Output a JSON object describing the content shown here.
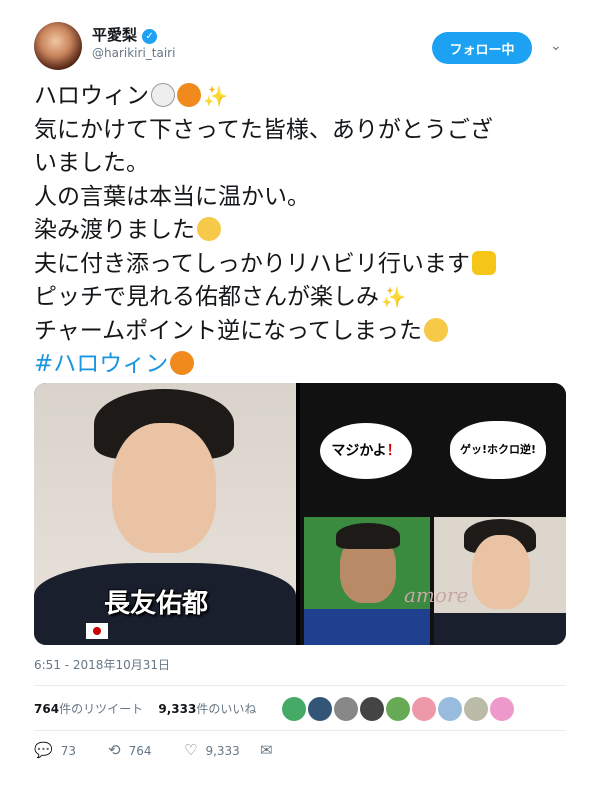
{
  "profile": {
    "name": "平愛梨",
    "handle": "@harikiri_tairi",
    "follow_label": "フォロー中"
  },
  "tweet": {
    "lines": [
      "ハロウィン",
      "気にかけて下さってた皆様、ありがとうござ",
      "いました。",
      "人の言葉は本当に温かい。",
      "染み渡りました",
      "夫に付き添ってしっかりリハビリ行います",
      "ピッチで見れる佑都さんが楽しみ",
      "チャームポイント逆になってしまった"
    ],
    "hashtag": "#ハロウィン",
    "sparkle": "✨"
  },
  "media": {
    "left_caption": "長友佑都",
    "bubble1": "マジかよ",
    "bubble1_mark": "！",
    "bubble2": "ゲッ!ホクロ逆!",
    "amore": "amore"
  },
  "timestamp": "6:51 - 2018年10月31日",
  "stats": {
    "retweets_count": "764",
    "retweets_label": "件のリツイート",
    "likes_count": "9,333",
    "likes_label": "件のいいね"
  },
  "actions": {
    "reply_count": "73",
    "retweet_count": "764",
    "like_count": "9,333"
  },
  "icons": {
    "verified": "verified-icon",
    "chevron": "chevron-down-icon",
    "reply": "reply-icon",
    "retweet": "retweet-icon",
    "like": "heart-icon",
    "dm": "mail-icon"
  },
  "colors": {
    "accent": "#1da1f2",
    "hashtag": "#1b95e0",
    "muted": "#657786"
  }
}
